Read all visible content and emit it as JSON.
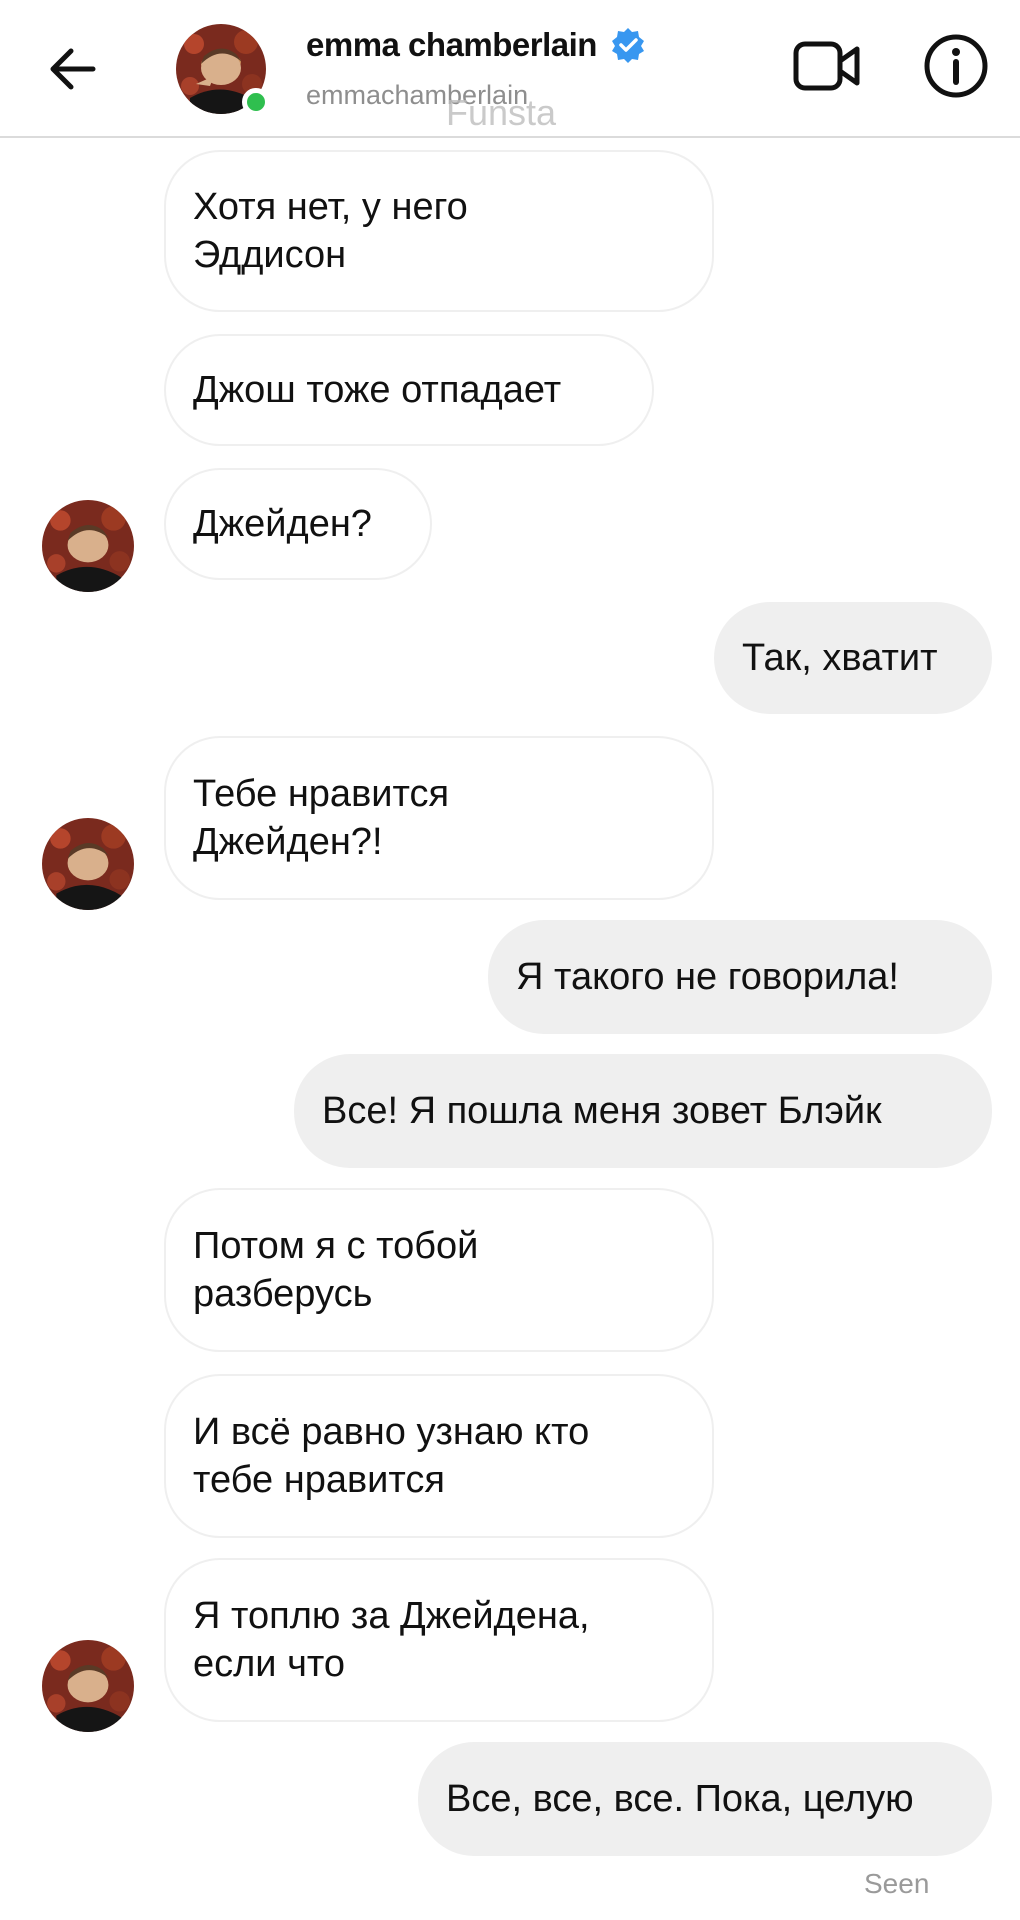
{
  "header": {
    "name": "emma chamberlain",
    "handle": "emmachamberlain",
    "watermark": "Funsta",
    "icons": {
      "back": "arrow-left-icon",
      "video": "video-camera-icon",
      "info": "info-icon",
      "verified": "verified-badge-icon"
    },
    "online": true
  },
  "messages": [
    {
      "from": "them",
      "lines": [
        "Хотя нет, у него",
        "Эддисон"
      ]
    },
    {
      "from": "them",
      "lines": [
        "Джош тоже отпадает"
      ]
    },
    {
      "from": "them",
      "lines": [
        "Джейден?"
      ]
    },
    {
      "from": "me",
      "lines": [
        "Так, хватит"
      ]
    },
    {
      "from": "them",
      "lines": [
        "Тебе нравится",
        "Джейден?!"
      ]
    },
    {
      "from": "me",
      "lines": [
        "Я такого не говорила!"
      ]
    },
    {
      "from": "me",
      "lines": [
        "Все! Я пошла меня зовет Блэйк"
      ]
    },
    {
      "from": "them",
      "lines": [
        "Потом я с тобой",
        "разберусь"
      ]
    },
    {
      "from": "them",
      "lines": [
        "И всё равно узнаю кто",
        "тебе нравится"
      ]
    },
    {
      "from": "them",
      "lines": [
        "Я топлю за Джейдена,",
        "если что"
      ]
    },
    {
      "from": "me",
      "lines": [
        "Все, все, все. Пока, целую"
      ]
    }
  ],
  "status": {
    "seen": "Seen"
  },
  "colors": {
    "incoming_bubble_border": "#efefef",
    "outgoing_bubble": "#efefef",
    "verified": "#3897f0",
    "online": "#2fbf4f",
    "text": "#111111",
    "muted": "#8e8e8e"
  }
}
